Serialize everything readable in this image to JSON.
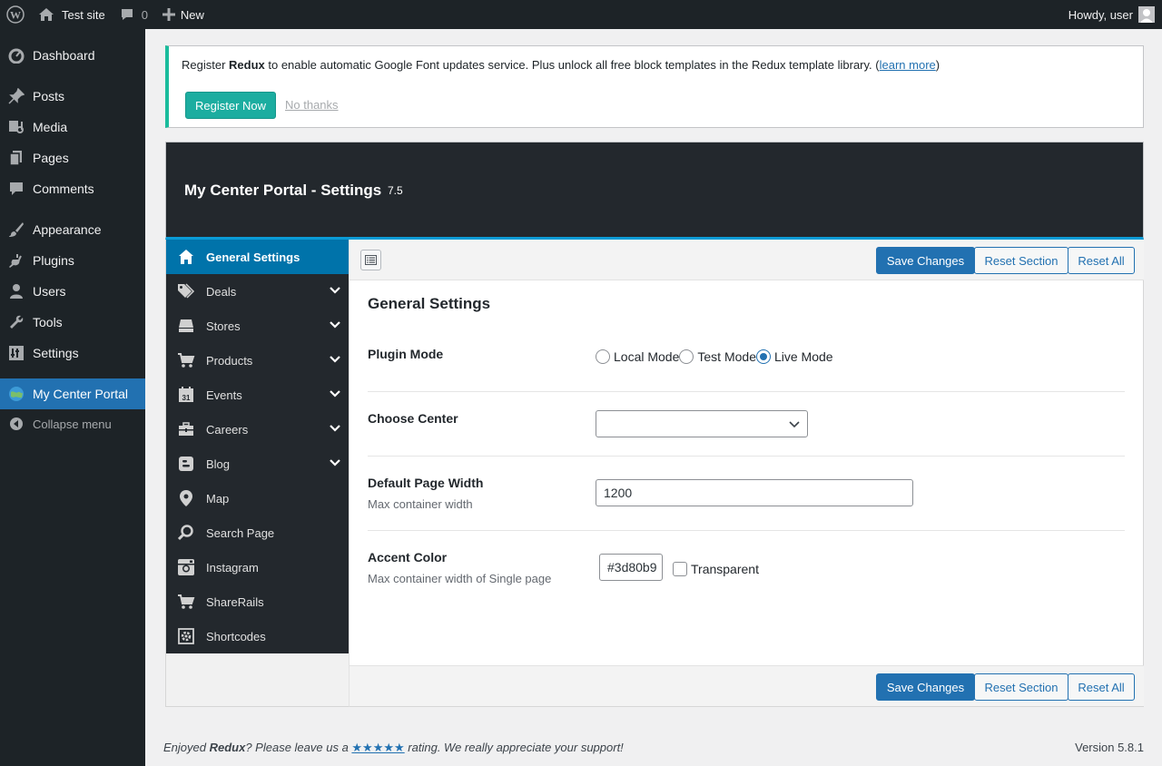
{
  "adminbar": {
    "site_name": "Test site",
    "comments_count": "0",
    "new_label": "New",
    "howdy": "Howdy, user"
  },
  "admin_menu": {
    "items": [
      {
        "label": "Dashboard",
        "icon": "dashboard-icon"
      },
      {
        "label": "Posts",
        "icon": "pin-icon"
      },
      {
        "label": "Media",
        "icon": "media-icon"
      },
      {
        "label": "Pages",
        "icon": "pages-icon"
      },
      {
        "label": "Comments",
        "icon": "comment-icon"
      },
      {
        "label": "Appearance",
        "icon": "brush-icon"
      },
      {
        "label": "Plugins",
        "icon": "plugin-icon"
      },
      {
        "label": "Users",
        "icon": "user-icon"
      },
      {
        "label": "Tools",
        "icon": "wrench-icon"
      },
      {
        "label": "Settings",
        "icon": "sliders-icon"
      },
      {
        "label": "My Center Portal",
        "icon": "globe-icon"
      },
      {
        "label": "Collapse menu",
        "icon": "collapse-icon"
      }
    ]
  },
  "notice": {
    "pre": "Register ",
    "brand": "Redux",
    "post": " to enable automatic Google Font updates service. Plus unlock all free block templates in the Redux template library. (",
    "learn_more": "learn more",
    "close_paren": ")",
    "register_button": "Register Now",
    "no_thanks": "No thanks"
  },
  "panel": {
    "title": "My Center Portal - Settings",
    "version": "7.5"
  },
  "redux_nav": [
    {
      "label": "General Settings",
      "icon": "home-icon",
      "expandable": false
    },
    {
      "label": "Deals",
      "icon": "tags-icon",
      "expandable": true
    },
    {
      "label": "Stores",
      "icon": "store-icon",
      "expandable": true
    },
    {
      "label": "Products",
      "icon": "cart-icon",
      "expandable": true
    },
    {
      "label": "Events",
      "icon": "calendar-icon",
      "expandable": true
    },
    {
      "label": "Careers",
      "icon": "briefcase-icon",
      "expandable": true
    },
    {
      "label": "Blog",
      "icon": "blogger-icon",
      "expandable": true
    },
    {
      "label": "Map",
      "icon": "map-marker-icon",
      "expandable": false
    },
    {
      "label": "Search Page",
      "icon": "search-icon",
      "expandable": false
    },
    {
      "label": "Instagram",
      "icon": "instagram-icon",
      "expandable": false
    },
    {
      "label": "ShareRails",
      "icon": "cart-icon",
      "expandable": false
    },
    {
      "label": "Shortcodes",
      "icon": "code-icon",
      "expandable": false
    }
  ],
  "actions": {
    "save": "Save Changes",
    "reset_section": "Reset Section",
    "reset_all": "Reset All"
  },
  "section": {
    "title": "General Settings",
    "plugin_mode": {
      "label": "Plugin Mode",
      "options": [
        "Local Mode",
        "Test Mode",
        "Live Mode"
      ],
      "selected": "Live Mode"
    },
    "choose_center": {
      "label": "Choose Center",
      "value": ""
    },
    "page_width": {
      "label": "Default Page Width",
      "desc": "Max container width",
      "value": "1200"
    },
    "accent_color": {
      "label": "Accent Color",
      "desc": "Max container width of Single page",
      "value": "#3d80b9",
      "transparent_label": "Transparent",
      "transparent_checked": false
    }
  },
  "footer": {
    "enjoyed": "Enjoyed ",
    "brand": "Redux",
    "mid": "? Please leave us a ",
    "stars": "★★★★★",
    "end": " rating. We really appreciate your support!",
    "version": "Version 5.8.1"
  }
}
